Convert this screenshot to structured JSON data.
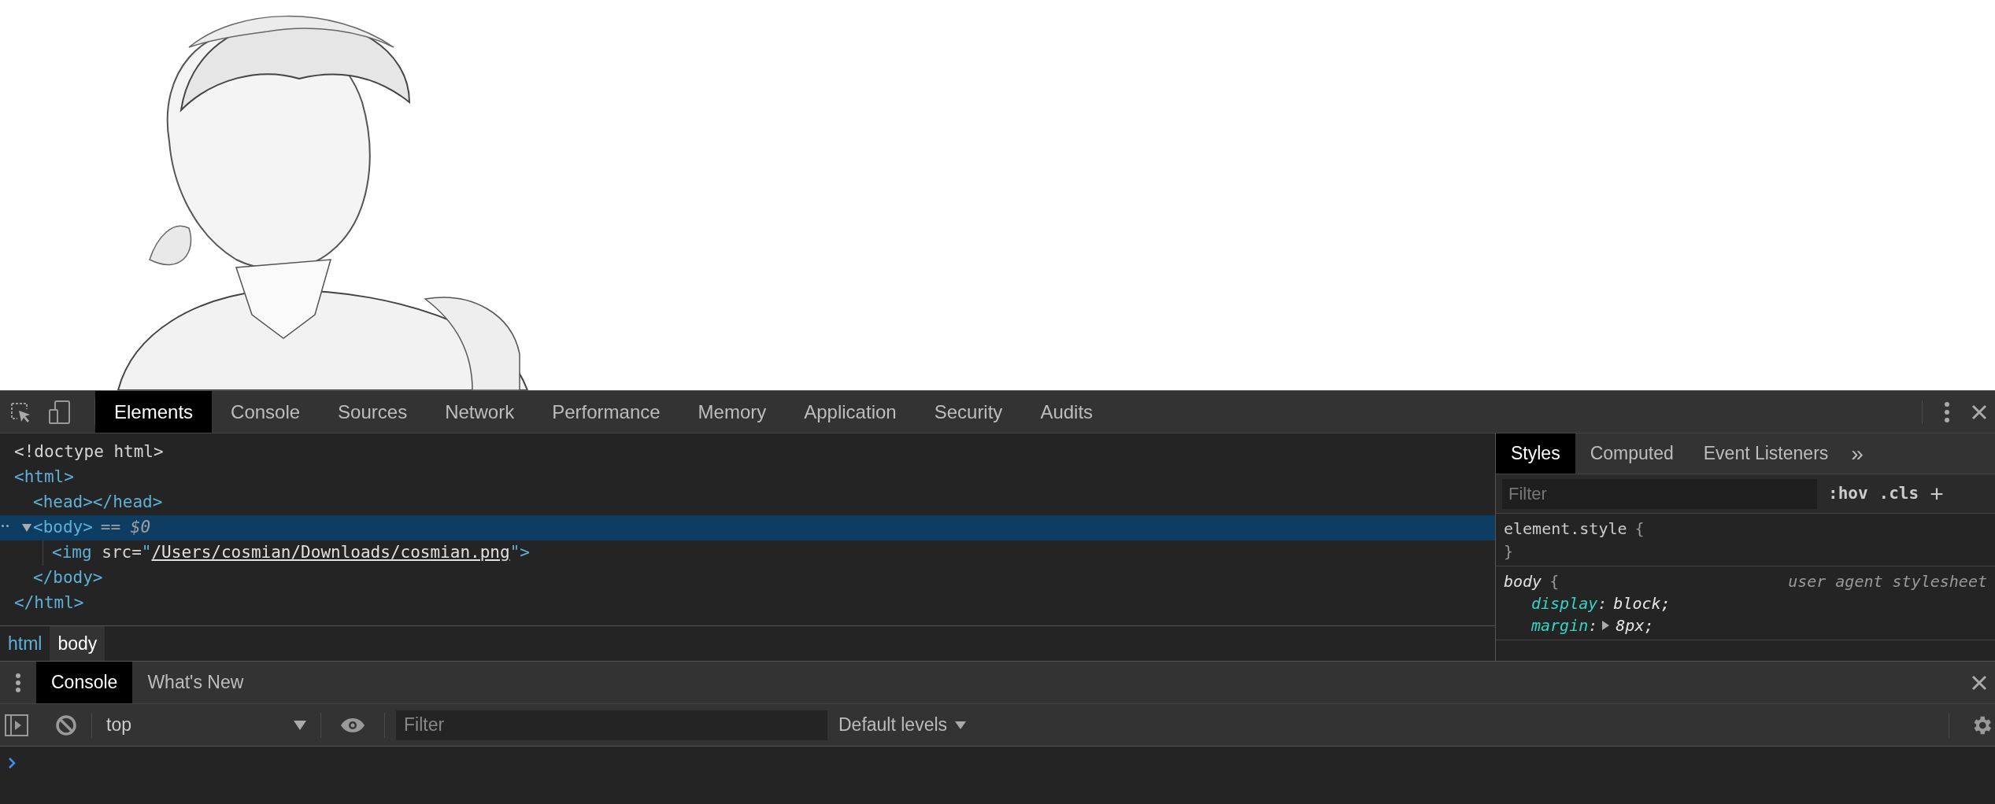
{
  "devtools": {
    "tabs": [
      {
        "label": "Elements",
        "selected": true
      },
      {
        "label": "Console",
        "selected": false
      },
      {
        "label": "Sources",
        "selected": false
      },
      {
        "label": "Network",
        "selected": false
      },
      {
        "label": "Performance",
        "selected": false
      },
      {
        "label": "Memory",
        "selected": false
      },
      {
        "label": "Application",
        "selected": false
      },
      {
        "label": "Security",
        "selected": false
      },
      {
        "label": "Audits",
        "selected": false
      }
    ],
    "elements": {
      "tree": [
        {
          "kind": "doctype",
          "text": "<!doctype html>"
        },
        {
          "kind": "element",
          "open": "<html>",
          "close": "</html>",
          "selected": false,
          "children": [
            {
              "kind": "leaf",
              "text": "<head></head>"
            },
            {
              "kind": "element",
              "open": "<body>",
              "suffix": "== $0",
              "close": "</body>",
              "expanded": true,
              "selected": true,
              "children": [
                {
                  "kind": "img",
                  "tag": "<img",
                  "attr": "src=",
                  "quote_open": "\"",
                  "url": "/Users/cosmian/Downloads/cosmian.png",
                  "tag_end": "\">"
                }
              ]
            }
          ]
        }
      ],
      "breadcrumbs": [
        {
          "label": "html",
          "selected": false
        },
        {
          "label": "body",
          "selected": true
        }
      ]
    },
    "styles": {
      "tabs": [
        {
          "label": "Styles",
          "selected": true
        },
        {
          "label": "Computed",
          "selected": false
        },
        {
          "label": "Event Listeners",
          "selected": false
        }
      ],
      "more": "»",
      "filter": {
        "placeholder": "Filter"
      },
      "hov": ":hov",
      "cls": ".cls",
      "add": "+",
      "rules": [
        {
          "selector": "element.style",
          "brace_open": "{",
          "brace_close": "}"
        },
        {
          "selector": "body",
          "brace_open": "{",
          "source": "user agent stylesheet",
          "declarations": [
            {
              "property": "display",
              "separator": ":",
              "value": "block;",
              "expandable": false
            },
            {
              "property": "margin",
              "separator": ":",
              "value": "8px;",
              "expandable": true
            }
          ]
        }
      ]
    },
    "drawer": {
      "tabs": [
        {
          "label": "Console",
          "selected": true
        },
        {
          "label": "What's New",
          "selected": false
        }
      ],
      "context": "top",
      "filter": {
        "placeholder": "Filter"
      },
      "levels": "Default levels"
    }
  }
}
